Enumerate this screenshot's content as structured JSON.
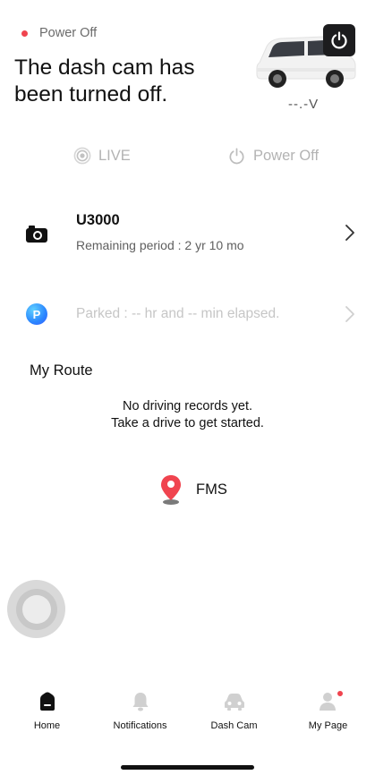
{
  "status": {
    "label": "Power Off",
    "dot_color": "#f0444f"
  },
  "headline": "The dash cam has been turned off.",
  "voltage": "--.-V",
  "modes": {
    "live_label": "LIVE",
    "power_off_label": "Power Off"
  },
  "device": {
    "name": "U3000",
    "remaining": "Remaining period : 2 yr 10 mo"
  },
  "parked": {
    "badge": "P",
    "text": "Parked : -- hr and -- min elapsed."
  },
  "route": {
    "title": "My Route",
    "empty_line1": "No driving records yet.",
    "empty_line2": "Take a drive to get started."
  },
  "fms": {
    "label": "FMS",
    "pin_color": "#f0444f"
  },
  "tabs": [
    {
      "label": "Home",
      "icon": "home-icon"
    },
    {
      "label": "Notifications",
      "icon": "bell-icon"
    },
    {
      "label": "Dash Cam",
      "icon": "car-icon"
    },
    {
      "label": "My Page",
      "icon": "person-icon"
    }
  ]
}
